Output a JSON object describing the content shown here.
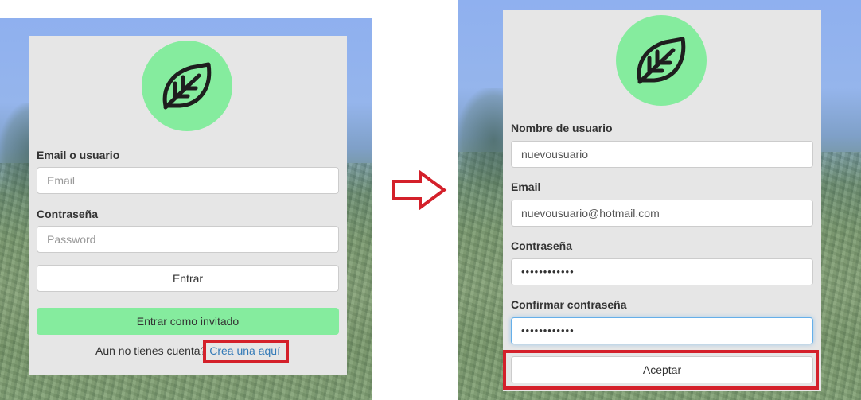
{
  "left_form": {
    "email_label": "Email o usuario",
    "email_placeholder": "Email",
    "password_label": "Contraseña",
    "password_placeholder": "Password",
    "login_button": "Entrar",
    "guest_button": "Entrar como invitado",
    "signup_prompt": "Aun no tienes cuenta?",
    "signup_link": "Crea una aquí"
  },
  "right_form": {
    "username_label": "Nombre de usuario",
    "username_value": "nuevousuario",
    "email_label": "Email",
    "email_value": "nuevousuario@hotmail.com",
    "password_label": "Contraseña",
    "password_value": "••••••••••••",
    "confirm_label": "Confirmar contraseña",
    "confirm_value": "••••••••••••",
    "accept_button": "Aceptar"
  },
  "colors": {
    "logo_bg": "#85ec9e",
    "guest_button_bg": "#85ec9e",
    "highlight": "#d4202a",
    "link": "#337ab7",
    "card_bg": "#e6e6e6"
  },
  "icons": {
    "logo": "leaf-icon",
    "transition": "right-arrow-icon"
  }
}
